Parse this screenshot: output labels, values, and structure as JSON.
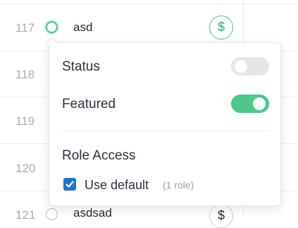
{
  "rows": [
    {
      "number": "117",
      "name": "asd",
      "price_icon": "dollar-icon",
      "price_symbol": "$"
    },
    {
      "number": "118"
    },
    {
      "number": "119"
    },
    {
      "number": "120"
    },
    {
      "number": "121",
      "name": "asdsad",
      "price_symbol": "$"
    }
  ],
  "popover": {
    "status_label": "Status",
    "status_on": false,
    "featured_label": "Featured",
    "featured_on": true,
    "role_access_label": "Role Access",
    "use_default_label": "Use default",
    "use_default_checked": true,
    "role_count_hint": "(1 role)"
  },
  "colors": {
    "accent_green": "#4cc88b",
    "checkbox_blue": "#1e73d6"
  }
}
